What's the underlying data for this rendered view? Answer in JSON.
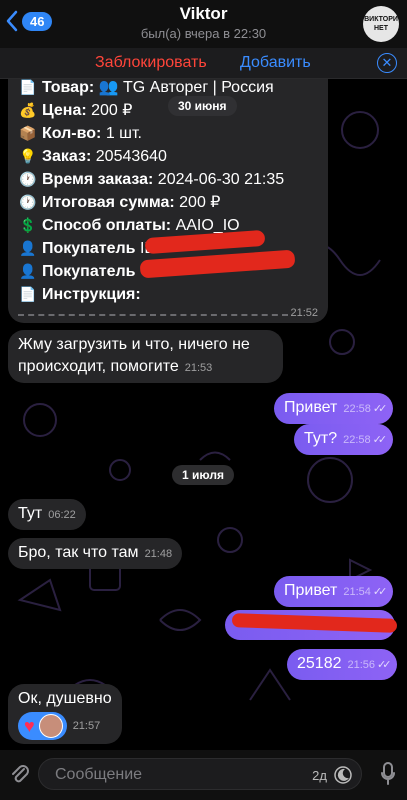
{
  "header": {
    "back_count": "46",
    "title": "Viktor",
    "subtitle": "был(а) вчера в 22:30",
    "avatar_text": "ВИКТОРИ НЕТ"
  },
  "actions": {
    "block": "Заблокировать",
    "add": "Добавить"
  },
  "order": {
    "lines": [
      {
        "icon": "📄",
        "label": "Товар:",
        "value": "👥 TG Авторег | Россия"
      },
      {
        "icon": "💰",
        "label": "Цена:",
        "value": "200 ₽"
      },
      {
        "icon": "📦",
        "label": "Кол-во:",
        "value": "1 шт."
      },
      {
        "icon": "💡",
        "label": "Заказ:",
        "value": "20543640"
      },
      {
        "icon": "🕐",
        "label": "Время заказа:",
        "value": "2024-06-30 21:35"
      },
      {
        "icon": "🕐",
        "label": "Итоговая сумма:",
        "value": "200 ₽"
      },
      {
        "icon": "💲",
        "label": "Способ оплаты:",
        "value": "AAIO_IO"
      },
      {
        "icon": "👤",
        "label": "Покупатель",
        "value": "ID"
      },
      {
        "icon": "👤",
        "label": "Покупатель",
        "value": ""
      },
      {
        "icon": "📄",
        "label": "Инструкция:",
        "value": ""
      }
    ],
    "time": "21:52"
  },
  "dates": {
    "first": "30 июня",
    "second": "1 июля"
  },
  "messages": {
    "m1": {
      "text_line1": "Жму загрузить и что, ничего не",
      "text_line2": "происходит, помогите",
      "time": "21:53"
    },
    "m2": {
      "text": "Привет",
      "time": "22:58"
    },
    "m3": {
      "text": "Тут?",
      "time": "22:58"
    },
    "m4": {
      "text": "Тут",
      "time": "06:22"
    },
    "m5": {
      "text": "Бро, так что там",
      "time": "21:48"
    },
    "m6": {
      "text": "Привет",
      "time": "21:54"
    },
    "m7": {
      "text": "",
      "time": ""
    },
    "m8": {
      "text": "25182",
      "time": "21:56"
    },
    "m9": {
      "text": "Ок, душевно",
      "time": "21:57"
    }
  },
  "input": {
    "placeholder": "Сообщение",
    "timer": "2д"
  },
  "colors": {
    "accent": "#3a8cff",
    "outgoing": "#8e63f5",
    "danger": "#ff453a"
  }
}
